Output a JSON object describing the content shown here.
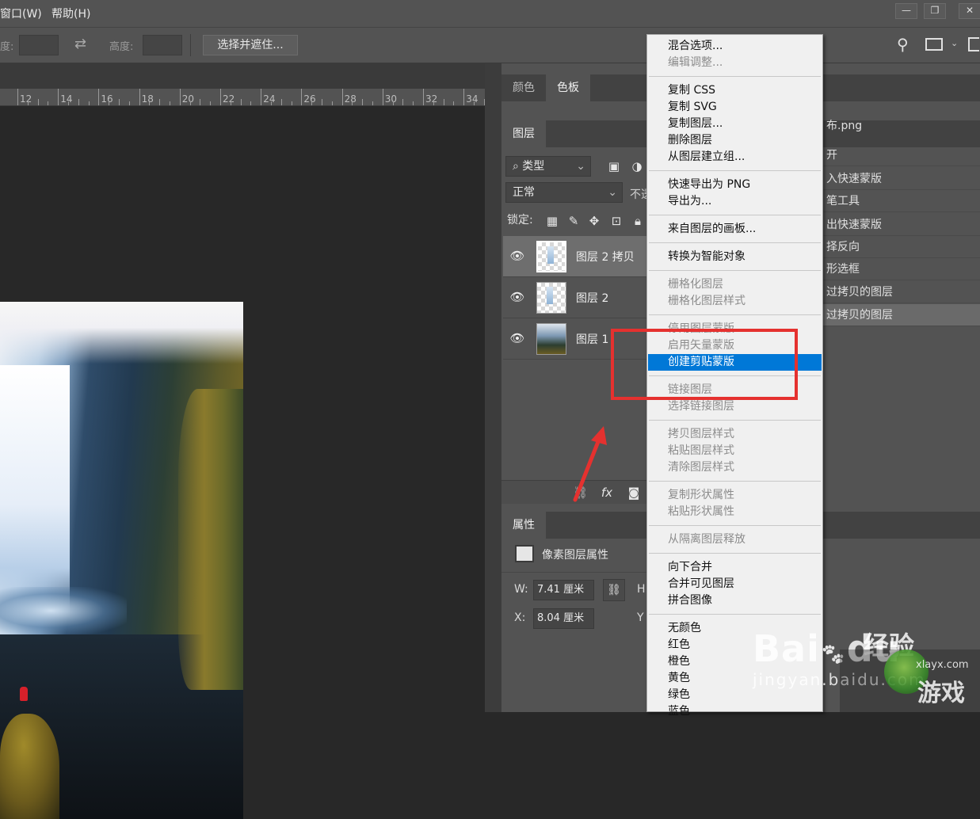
{
  "menubar": {
    "window": "窗口(W)",
    "help": "帮助(H)"
  },
  "optionsbar": {
    "width_label": "度:",
    "swap_icon": "swap-arrows-icon",
    "height_label": "高度:",
    "select_mask_button": "选择并遮住..."
  },
  "ruler": {
    "marks": [
      "12",
      "14",
      "16",
      "18",
      "20",
      "22",
      "24",
      "26",
      "28",
      "30",
      "32",
      "34"
    ]
  },
  "color_panel": {
    "tabs": [
      "颜色",
      "色板"
    ]
  },
  "layers_panel": {
    "tab": "图层",
    "filter_kind": "类型",
    "blend_mode": "正常",
    "opacity_label": "不透",
    "lock_label": "锁定:",
    "layers": [
      {
        "name": "图层 2 拷贝",
        "visible": true,
        "selected": true
      },
      {
        "name": "图层 2",
        "visible": true,
        "selected": false
      },
      {
        "name": "图层 1",
        "visible": true,
        "selected": false
      }
    ],
    "bottom_icons": [
      "link-icon",
      "fx-icon",
      "mask-icon"
    ]
  },
  "history_panel": {
    "doc_name": "布.png",
    "items": [
      "开",
      "入快速蒙版",
      "笔工具",
      "出快速蒙版",
      "择反向",
      "形选框",
      "过拷贝的图层",
      "过拷贝的图层"
    ]
  },
  "properties_panel": {
    "tab": "属性",
    "header": "像素图层属性",
    "w_label": "W:",
    "w_value": "7.41 厘米",
    "x_label": "X:",
    "x_value": "8.04 厘米",
    "h_label": "H",
    "y_label": "Y"
  },
  "context_menu": {
    "items": [
      {
        "label": "混合选项...",
        "disabled": false
      },
      {
        "label": "编辑调整...",
        "disabled": true
      },
      {
        "label": "复制 CSS",
        "disabled": false
      },
      {
        "label": "复制 SVG",
        "disabled": false
      },
      {
        "label": "复制图层...",
        "disabled": false
      },
      {
        "label": "删除图层",
        "disabled": false
      },
      {
        "label": "从图层建立组...",
        "disabled": false
      },
      {
        "label": "快速导出为 PNG",
        "disabled": false
      },
      {
        "label": "导出为...",
        "disabled": false
      },
      {
        "label": "来自图层的画板...",
        "disabled": false
      },
      {
        "label": "转换为智能对象",
        "disabled": false
      },
      {
        "label": "栅格化图层",
        "disabled": true
      },
      {
        "label": "栅格化图层样式",
        "disabled": true
      },
      {
        "label": "停用图层蒙版",
        "disabled": true
      },
      {
        "label": "启用矢量蒙版",
        "disabled": true
      },
      {
        "label": "创建剪贴蒙版",
        "disabled": false,
        "highlighted": true
      },
      {
        "label": "链接图层",
        "disabled": true
      },
      {
        "label": "选择链接图层",
        "disabled": true
      },
      {
        "label": "拷贝图层样式",
        "disabled": true
      },
      {
        "label": "粘贴图层样式",
        "disabled": true
      },
      {
        "label": "清除图层样式",
        "disabled": true
      },
      {
        "label": "复制形状属性",
        "disabled": true
      },
      {
        "label": "粘贴形状属性",
        "disabled": true
      },
      {
        "label": "从隔离图层释放",
        "disabled": true
      },
      {
        "label": "向下合并",
        "disabled": false
      },
      {
        "label": "合并可见图层",
        "disabled": false
      },
      {
        "label": "拼合图像",
        "disabled": false
      },
      {
        "label": "无颜色",
        "disabled": false
      },
      {
        "label": "红色",
        "disabled": false
      },
      {
        "label": "橙色",
        "disabled": false
      },
      {
        "label": "黄色",
        "disabled": false
      },
      {
        "label": "绿色",
        "disabled": false
      },
      {
        "label": "蓝色",
        "disabled": false
      }
    ]
  },
  "watermark": {
    "baidu": "Bai",
    "du": "du",
    "jingyan": "经验",
    "url": "jingyan.baidu.com",
    "site_logo": "xlayx.com",
    "site_text": "游戏"
  },
  "colors": {
    "highlight": "#0078d7",
    "annotation_red": "#e5312f",
    "panel": "#535353",
    "canvas_bg": "#282828"
  }
}
